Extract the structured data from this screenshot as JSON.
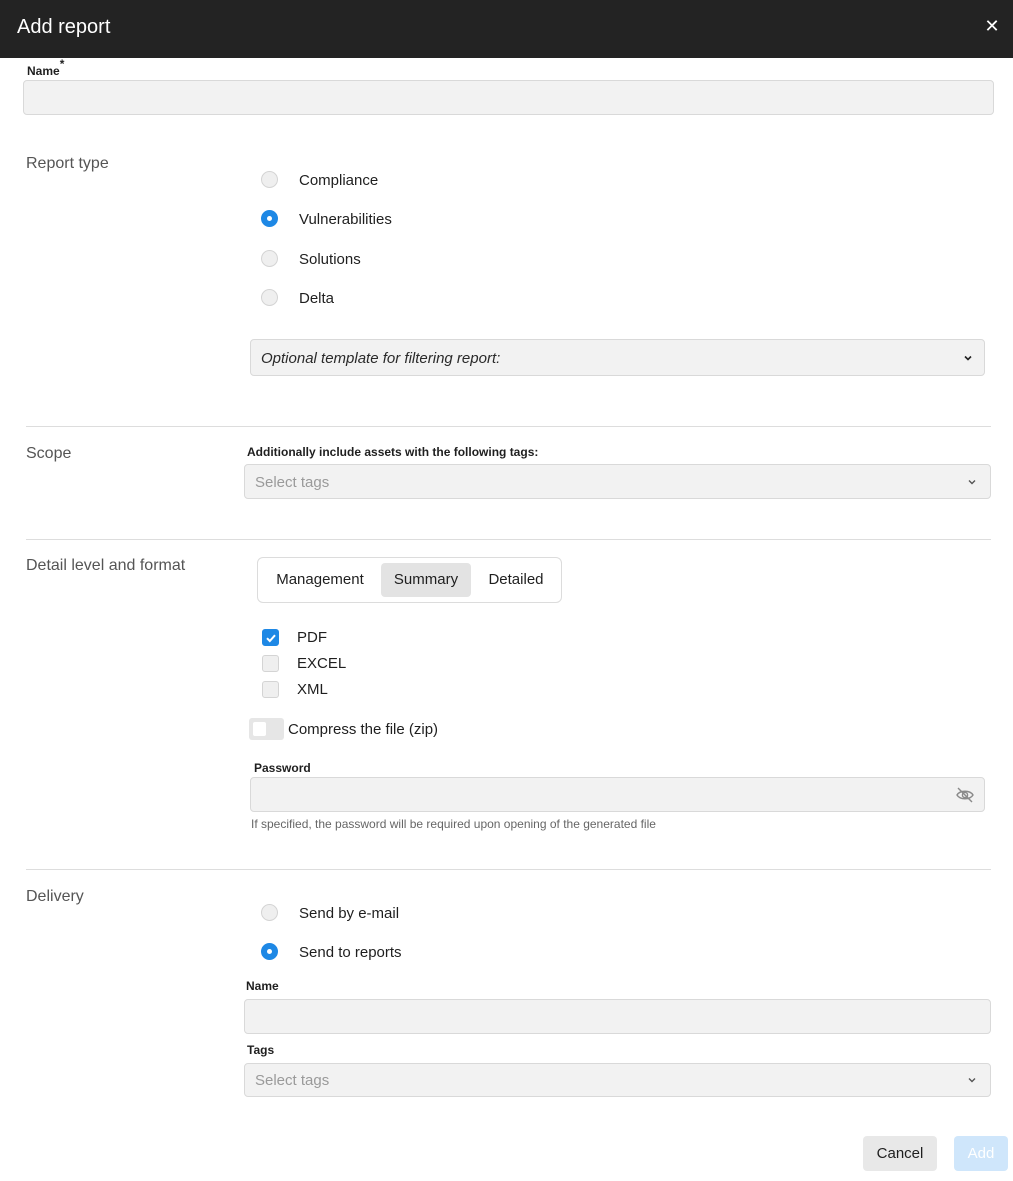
{
  "dialog": {
    "title": "Add report"
  },
  "name_field": {
    "label": "Name",
    "required_mark": "*",
    "value": "",
    "placeholder": ""
  },
  "report_type": {
    "label": "Report type",
    "options": [
      {
        "label": "Compliance",
        "checked": false
      },
      {
        "label": "Vulnerabilities",
        "checked": true
      },
      {
        "label": "Solutions",
        "checked": false
      },
      {
        "label": "Delta",
        "checked": false
      }
    ],
    "template_select": {
      "value": "Optional template for filtering report:"
    }
  },
  "scope": {
    "label": "Scope",
    "tags_label": "Additionally include assets with the following tags:",
    "tags_placeholder": "Select tags"
  },
  "detail": {
    "label": "Detail level and format",
    "levels": [
      {
        "label": "Management",
        "active": false
      },
      {
        "label": "Summary",
        "active": true
      },
      {
        "label": "Detailed",
        "active": false
      }
    ],
    "formats": [
      {
        "label": "PDF",
        "checked": true
      },
      {
        "label": "EXCEL",
        "checked": false
      },
      {
        "label": "XML",
        "checked": false
      }
    ],
    "compress": {
      "label": "Compress the file (zip)",
      "on": false
    },
    "password": {
      "label": "Password",
      "value": "",
      "hint": "If specified, the password will be required upon opening of the generated file"
    }
  },
  "delivery": {
    "label": "Delivery",
    "options": [
      {
        "label": "Send by e-mail",
        "checked": false
      },
      {
        "label": "Send to reports",
        "checked": true
      }
    ],
    "name_label": "Name",
    "name_value": "",
    "tags_label": "Tags",
    "tags_placeholder": "Select tags"
  },
  "footer": {
    "cancel": "Cancel",
    "add": "Add"
  },
  "colors": {
    "accent": "#1e88e5",
    "titlebar": "#232323",
    "add_disabled": "#cfe6fb"
  }
}
